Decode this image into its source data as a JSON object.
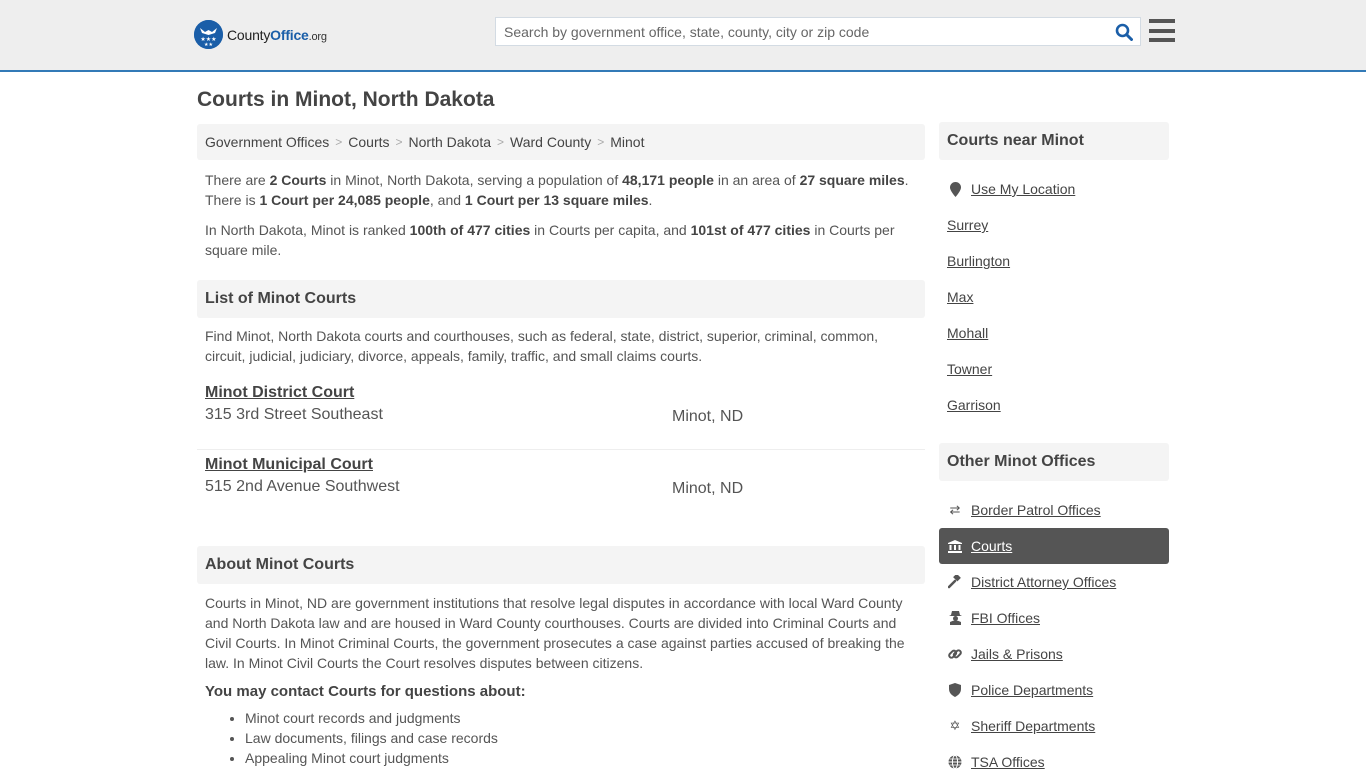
{
  "header": {
    "logo": {
      "county": "County",
      "office": "Office",
      "org": ".org"
    },
    "search": {
      "placeholder": "Search by government office, state, county, city or zip code",
      "value": ""
    },
    "icons": {
      "search": "search-icon",
      "menu": "hamburger-menu-icon"
    }
  },
  "page_title": "Courts in Minot, North Dakota",
  "breadcrumb": [
    {
      "label": "Government Offices"
    },
    {
      "label": "Courts"
    },
    {
      "label": "North Dakota"
    },
    {
      "label": "Ward County"
    },
    {
      "label": "Minot"
    }
  ],
  "summary": {
    "p1": {
      "t1": "There are ",
      "b1": "2 Courts",
      "t2": " in Minot, North Dakota, serving a population of ",
      "b2": "48,171 people",
      "t3": " in an area of ",
      "b3": "27 square miles",
      "t4": ". There is ",
      "b4": "1 Court per 24,085 people",
      "t5": ", and ",
      "b5": "1 Court per 13 square miles",
      "t6": "."
    },
    "p2": {
      "t1": "In North Dakota, Minot is ranked ",
      "b1": "100th of 477 cities",
      "t2": " in Courts per capita, and ",
      "b2": "101st of 477 cities",
      "t3": " in Courts per square mile."
    }
  },
  "list_section": {
    "title": "List of Minot Courts",
    "description": "Find Minot, North Dakota courts and courthouses, such as federal, state, district, superior, criminal, common, circuit, judicial, judiciary, divorce, appeals, family, traffic, and small claims courts.",
    "courts": [
      {
        "name": "Minot District Court",
        "address": "315 3rd Street Southeast",
        "city": "Minot, ND"
      },
      {
        "name": "Minot Municipal Court",
        "address": "515 2nd Avenue Southwest",
        "city": "Minot, ND"
      }
    ]
  },
  "about_section": {
    "title": "About Minot Courts",
    "body": "Courts in Minot, ND are government institutions that resolve legal disputes in accordance with local Ward County and North Dakota law and are housed in Ward County courthouses. Courts are divided into Criminal Courts and Civil Courts. In Minot Criminal Courts, the government prosecutes a case against parties accused of breaking the law. In Minot Civil Courts the Court resolves disputes between citizens.",
    "contact_heading": "You may contact Courts for questions about:",
    "contact_items": [
      "Minot court records and judgments",
      "Law documents, filings and case records",
      "Appealing Minot court judgments"
    ]
  },
  "sidebar": {
    "nearby": {
      "title": "Courts near Minot",
      "use_location": "Use My Location",
      "cities": [
        "Surrey",
        "Burlington",
        "Max",
        "Mohall",
        "Towner",
        "Garrison"
      ]
    },
    "other": {
      "title": "Other Minot Offices",
      "items": [
        {
          "label": "Border Patrol Offices",
          "icon": "arrows-exchange-icon",
          "active": false
        },
        {
          "label": "Courts",
          "icon": "courthouse-icon",
          "active": true
        },
        {
          "label": "District Attorney Offices",
          "icon": "gavel-icon",
          "active": false
        },
        {
          "label": "FBI Offices",
          "icon": "spy-icon",
          "active": false
        },
        {
          "label": "Jails & Prisons",
          "icon": "chain-link-icon",
          "active": false
        },
        {
          "label": "Police Departments",
          "icon": "shield-icon",
          "active": false
        },
        {
          "label": "Sheriff Departments",
          "icon": "star-badge-icon",
          "active": false
        },
        {
          "label": "TSA Offices",
          "icon": "globe-icon",
          "active": false
        }
      ]
    }
  },
  "colors": {
    "brand_blue": "#1a5ea8",
    "header_border": "#337ab7",
    "active_item_bg": "#555555"
  }
}
